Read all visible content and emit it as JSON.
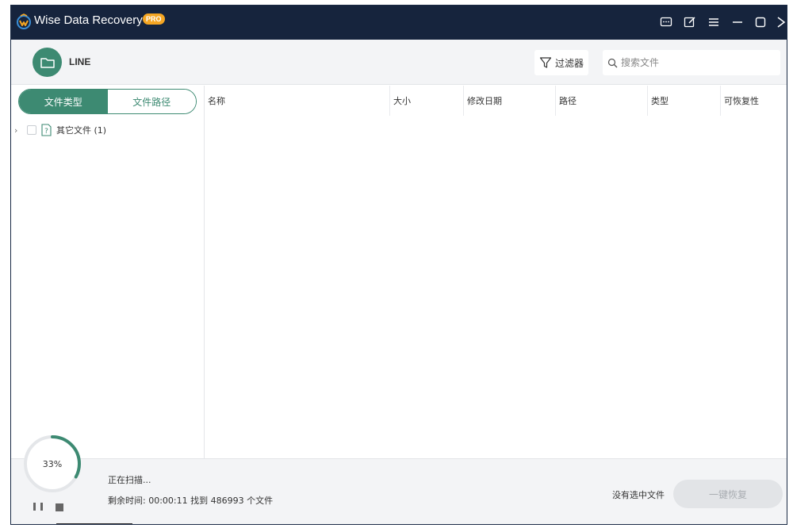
{
  "titlebar": {
    "app_title": "Wise Data Recovery",
    "badge": "PRO",
    "colors": {
      "background": "#16243d",
      "badge": "#f5a623"
    },
    "icons": [
      "feedback-icon",
      "edit-icon",
      "menu-icon",
      "minimize-icon",
      "maximize-icon",
      "close-icon"
    ]
  },
  "header": {
    "drive_label": "LINE",
    "filter_label": "过滤器",
    "search_placeholder": "搜索文件"
  },
  "left_panel": {
    "tabs": [
      {
        "label": "文件类型",
        "active": true
      },
      {
        "label": "文件路径",
        "active": false
      }
    ],
    "tree": [
      {
        "label": "其它文件 (1)",
        "icon": "unknown-file-icon",
        "checked": false,
        "expanded": false
      }
    ]
  },
  "table": {
    "columns": [
      "名称",
      "大小",
      "修改日期",
      "路径",
      "类型",
      "可恢复性"
    ],
    "rows": []
  },
  "footer": {
    "progress_percent": 33,
    "progress_label": "33%",
    "status": "正在扫描...",
    "stats": "剩余时间: 00:00:11  找到 486993 个文件",
    "no_selection": "没有选中文件",
    "recover_button": "一键恢复",
    "colors": {
      "accent": "#3d8a72"
    }
  }
}
